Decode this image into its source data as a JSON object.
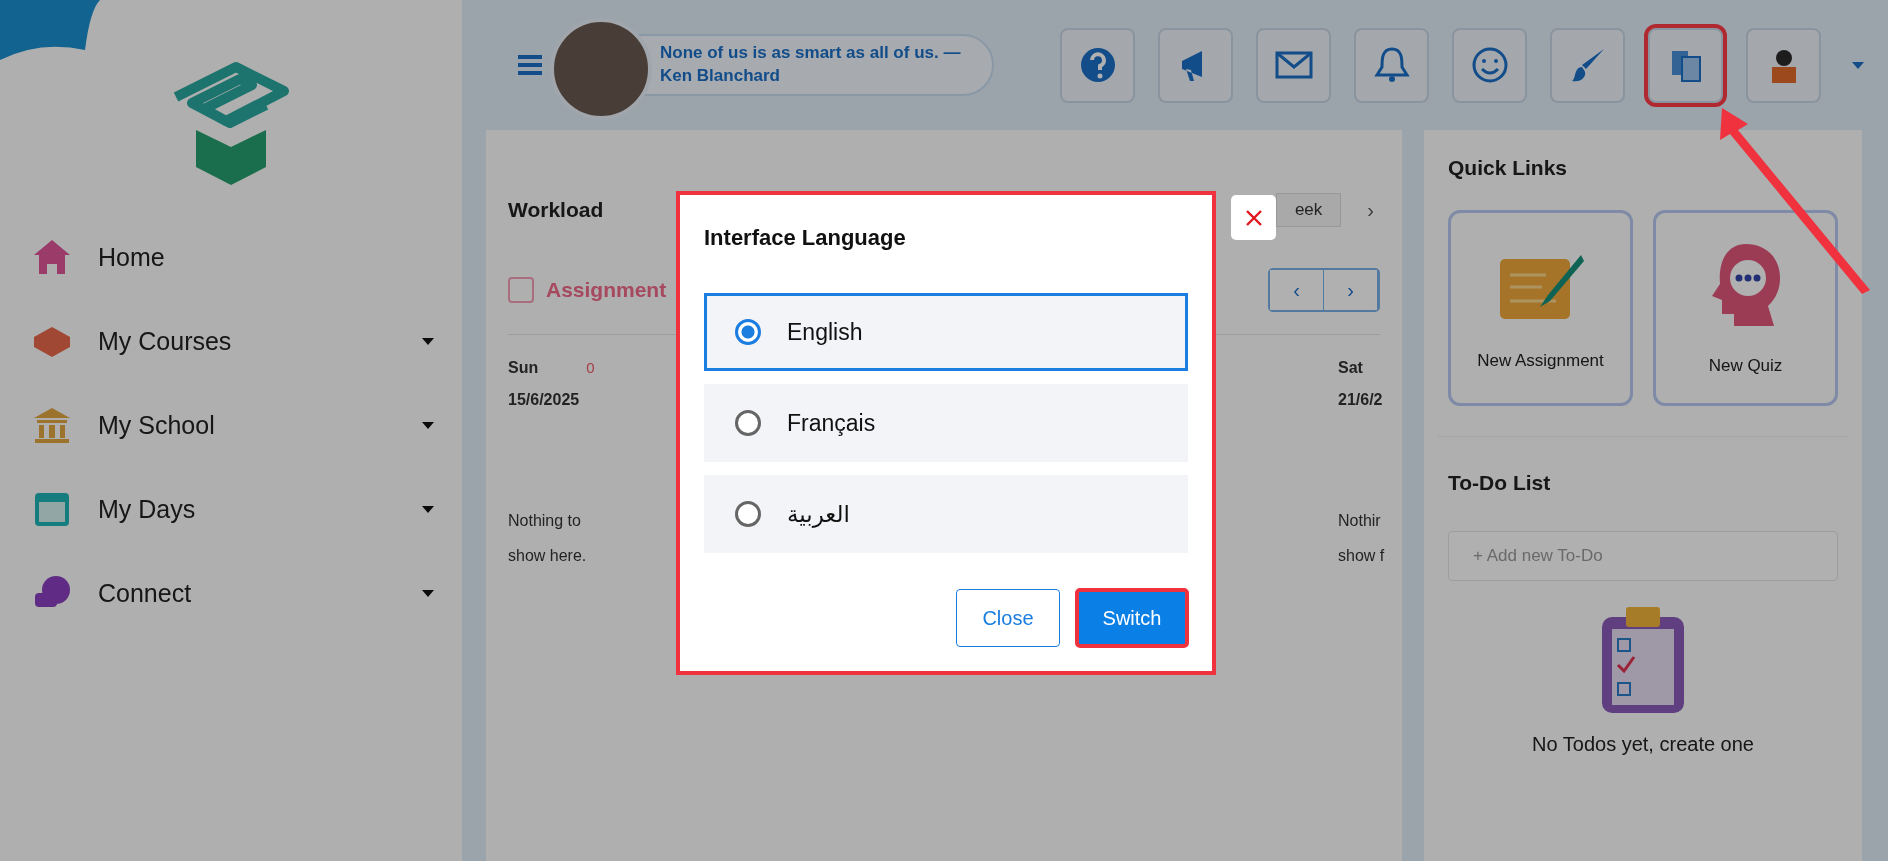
{
  "sidebar": {
    "items": [
      {
        "label": "Home",
        "expandable": false
      },
      {
        "label": "My Courses",
        "expandable": true
      },
      {
        "label": "My School",
        "expandable": true
      },
      {
        "label": "My Days",
        "expandable": true
      },
      {
        "label": "Connect",
        "expandable": true
      }
    ]
  },
  "header": {
    "quote": "None of us is as smart as all of us. — Ken Blanchard",
    "toolbar": [
      {
        "highlighted": false
      },
      {
        "highlighted": false
      },
      {
        "highlighted": false
      },
      {
        "highlighted": false
      },
      {
        "highlighted": false
      },
      {
        "highlighted": false
      },
      {
        "highlighted": true
      },
      {
        "highlighted": false
      }
    ]
  },
  "workload": {
    "title": "Workload",
    "period": "eek",
    "period_next": "›",
    "filter": {
      "label": "Assignment",
      "checked": false
    },
    "nav": [
      "‹",
      "›"
    ],
    "days": [
      {
        "day": "Sun",
        "count": "0",
        "date": "15/6/2025",
        "empty": "Nothing to show here."
      },
      {
        "day": "Sat",
        "date": "21/6/2",
        "empty": "Nothir show f"
      }
    ]
  },
  "quick_links": {
    "title": "Quick Links",
    "items": [
      "New Assignment",
      "New Quiz"
    ]
  },
  "todo": {
    "title": "To-Do List",
    "placeholder": "+ Add new To-Do",
    "empty": "No Todos yet, create one"
  },
  "dialog": {
    "title": "Interface Language",
    "highlighted": true,
    "options": [
      {
        "label": "English",
        "selected": true
      },
      {
        "label": "Français",
        "selected": false
      },
      {
        "label": "العربية",
        "selected": false
      }
    ],
    "buttons": [
      {
        "label": "Close",
        "kind": "secondary",
        "highlighted": false
      },
      {
        "label": "Switch",
        "kind": "primary",
        "highlighted": true
      }
    ]
  }
}
